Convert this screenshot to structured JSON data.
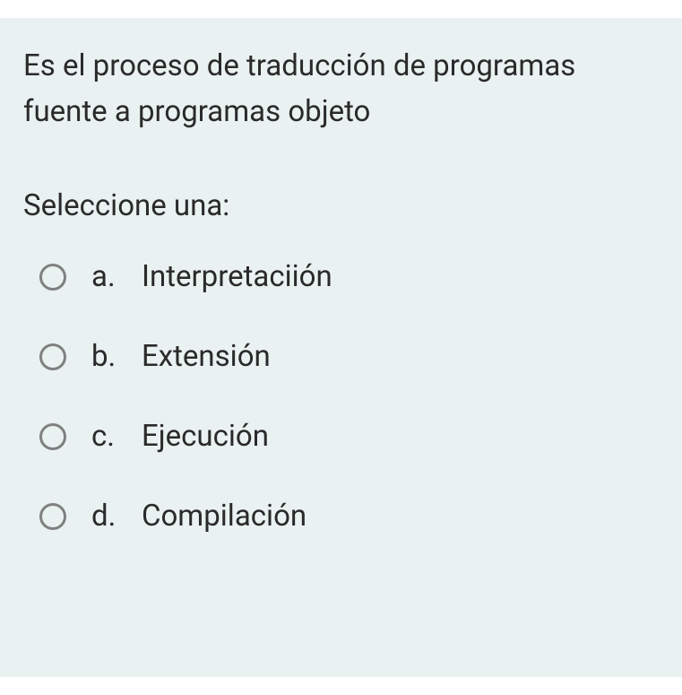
{
  "question": {
    "text": "Es el proceso de traducción de programas fuente a programas objeto",
    "prompt": "Seleccione una:",
    "options": [
      {
        "letter": "a.",
        "text": "Interpretaciión"
      },
      {
        "letter": "b.",
        "text": "Extensión"
      },
      {
        "letter": "c.",
        "text": "Ejecución"
      },
      {
        "letter": "d.",
        "text": "Compilación"
      }
    ]
  }
}
